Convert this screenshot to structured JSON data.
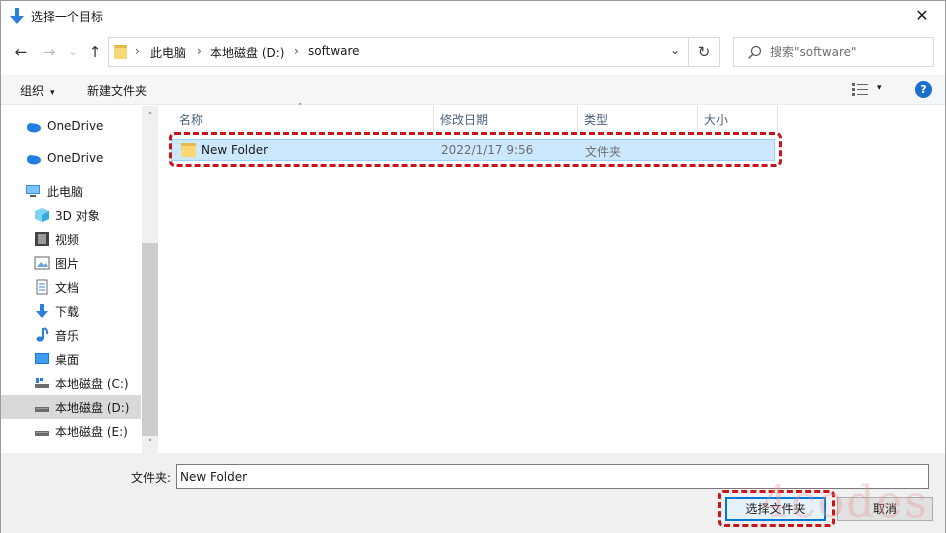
{
  "window": {
    "title": "选择一个目标",
    "close_glyph": "✕"
  },
  "nav": {
    "back": "←",
    "forward": "→",
    "recent": "⌄",
    "up": "↑",
    "breadcrumbs": [
      "此电脑",
      "本地磁盘 (D:)",
      "software"
    ],
    "separator": "›",
    "dropdown": "⌄",
    "refresh": "↻",
    "search_placeholder": "搜索\"software\""
  },
  "toolbar": {
    "organize": "组织",
    "new_folder": "新建文件夹",
    "help": "?",
    "caret": "▾"
  },
  "sidebar": {
    "items": [
      {
        "label": "OneDrive",
        "icon": "cloud-icon"
      },
      {
        "label": "OneDrive",
        "icon": "cloud-icon"
      },
      {
        "label": "此电脑",
        "icon": "computer-icon"
      },
      {
        "label": "3D 对象",
        "icon": "cube-icon"
      },
      {
        "label": "视频",
        "icon": "video-icon"
      },
      {
        "label": "图片",
        "icon": "picture-icon"
      },
      {
        "label": "文档",
        "icon": "document-icon"
      },
      {
        "label": "下载",
        "icon": "download-icon"
      },
      {
        "label": "音乐",
        "icon": "music-icon"
      },
      {
        "label": "桌面",
        "icon": "desktop-icon"
      },
      {
        "label": "本地磁盘 (C:)",
        "icon": "drive-icon"
      },
      {
        "label": "本地磁盘 (D:)",
        "icon": "drive-icon",
        "selected": true
      },
      {
        "label": "本地磁盘 (E:)",
        "icon": "drive-icon"
      }
    ],
    "scroll_up": "˄",
    "scroll_down": "˅"
  },
  "list": {
    "columns": [
      "名称",
      "修改日期",
      "类型",
      "大小"
    ],
    "sort_caret": "˄",
    "rows": [
      {
        "name": "New Folder",
        "modified": "2022/1/17 9:56",
        "type": "文件夹",
        "size": ""
      }
    ]
  },
  "footer": {
    "folder_label": "文件夹:",
    "folder_value": "New Folder",
    "select_button": "选择文件夹",
    "cancel_button": "取消"
  },
  "watermark": "4codes",
  "colors": {
    "accent": "#0078d7",
    "selection": "#cce8ff",
    "highlight": "#c8141c"
  }
}
